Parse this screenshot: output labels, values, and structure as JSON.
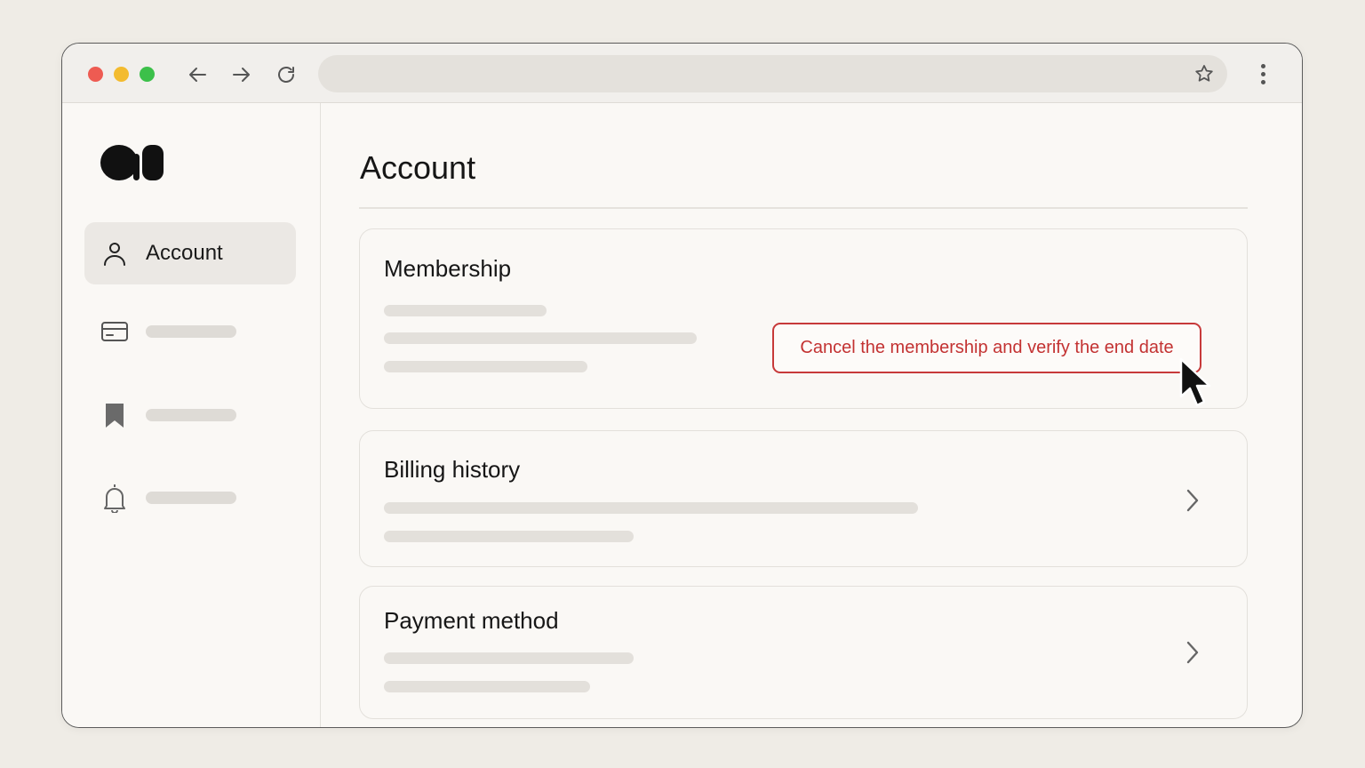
{
  "browser": {
    "address_text": "",
    "icons": [
      "arrow-left-icon",
      "arrow-right-icon",
      "reload-icon",
      "star-icon",
      "more-vertical-icon"
    ]
  },
  "sidebar": {
    "items": [
      {
        "label": "Account",
        "icon": "user-icon",
        "active": true
      },
      {
        "label": "",
        "icon": "credit-card-icon",
        "active": false
      },
      {
        "label": "",
        "icon": "bookmark-icon",
        "active": false
      },
      {
        "label": "",
        "icon": "bell-icon",
        "active": false
      }
    ]
  },
  "main": {
    "title": "Account",
    "cards": [
      {
        "title": "Membership",
        "action_label": "Cancel the membership and verify the end date"
      },
      {
        "title": "Billing history"
      },
      {
        "title": "Payment method"
      }
    ]
  },
  "colors": {
    "accent_danger": "#c73a3a",
    "traffic_red": "#ee5b52",
    "traffic_yellow": "#f3bb2f",
    "traffic_green": "#3cc04a"
  }
}
